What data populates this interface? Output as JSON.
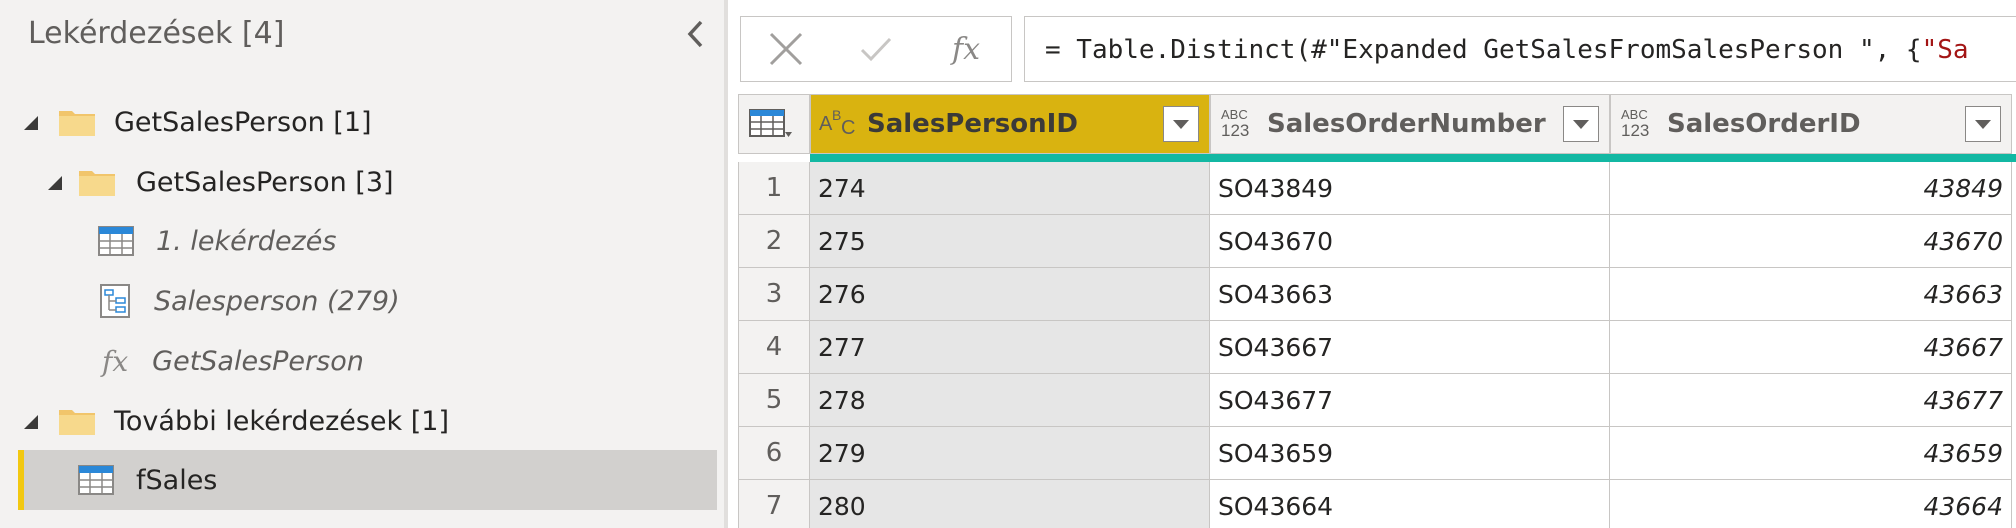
{
  "queries_pane": {
    "title": "Lekérdezések [4]",
    "tree": [
      {
        "label": "GetSalesPerson [1]",
        "kind": "folder",
        "level": 0,
        "expanded": true
      },
      {
        "label": "GetSalesPerson [3]",
        "kind": "folder",
        "level": 1,
        "expanded": true
      },
      {
        "label": "1. lekérdezés",
        "kind": "table",
        "level": 2
      },
      {
        "label": "Salesperson (279)",
        "kind": "parameter",
        "level": 2
      },
      {
        "label": "GetSalesPerson",
        "kind": "function",
        "level": 2
      },
      {
        "label": "További lekérdezések [1]",
        "kind": "folder",
        "level": 0,
        "expanded": true
      },
      {
        "label": "fSales",
        "kind": "table",
        "level": 1,
        "selected": true
      }
    ]
  },
  "formula_bar": {
    "prefix": "= Table.Distinct(#\"Expanded GetSalesFromSalesPerson \", {",
    "string_tail": "\"Sa",
    "fx_label": "fx"
  },
  "grid": {
    "columns": [
      {
        "name": "SalesPersonID",
        "type_top": "A",
        "type_mid": "B",
        "type_bot": "C",
        "selected": true
      },
      {
        "name": "SalesOrderNumber",
        "type_top": "ABC",
        "type_bot": "123",
        "selected": false
      },
      {
        "name": "SalesOrderID",
        "type_top": "ABC",
        "type_bot": "123",
        "selected": false
      }
    ],
    "rows": [
      {
        "n": "1",
        "SalesPersonID": "274",
        "SalesOrderNumber": "SO43849",
        "SalesOrderID": "43849"
      },
      {
        "n": "2",
        "SalesPersonID": "275",
        "SalesOrderNumber": "SO43670",
        "SalesOrderID": "43670"
      },
      {
        "n": "3",
        "SalesPersonID": "276",
        "SalesOrderNumber": "SO43663",
        "SalesOrderID": "43663"
      },
      {
        "n": "4",
        "SalesPersonID": "277",
        "SalesOrderNumber": "SO43667",
        "SalesOrderID": "43667"
      },
      {
        "n": "5",
        "SalesPersonID": "278",
        "SalesOrderNumber": "SO43677",
        "SalesOrderID": "43677"
      },
      {
        "n": "6",
        "SalesPersonID": "279",
        "SalesOrderNumber": "SO43659",
        "SalesOrderID": "43659"
      },
      {
        "n": "7",
        "SalesPersonID": "280",
        "SalesOrderNumber": "SO43664",
        "SalesOrderID": "43664"
      }
    ]
  },
  "colors": {
    "selected_column": "#d9b310",
    "quality_bar": "#13b8a3",
    "selection_accent": "#f2c811"
  }
}
